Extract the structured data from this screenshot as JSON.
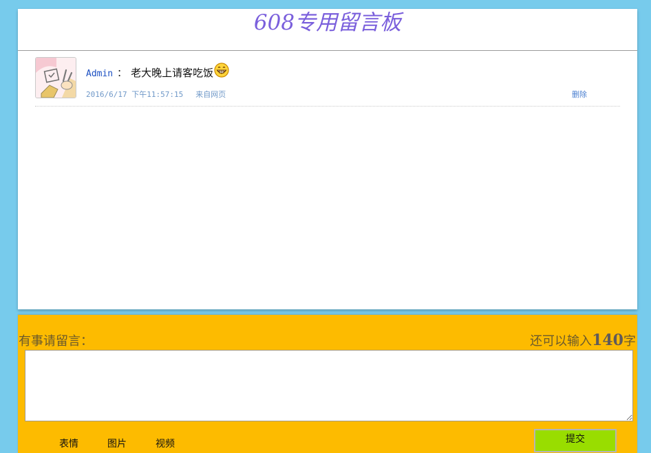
{
  "board": {
    "title": "608专用留言板",
    "messages": [
      {
        "author": "Admin",
        "separator": "：",
        "text": "老大晚上请客吃饭",
        "emoji": "grinning-face-icon",
        "time": "2016/6/17 下午11:57:15",
        "source": "来自网页",
        "delete_label": "删除"
      }
    ]
  },
  "compose": {
    "label": "有事请留言：",
    "count_prefix": "还可以输入",
    "count_value": "140",
    "count_suffix": "字",
    "textarea_value": "",
    "tools": [
      "表情",
      "图片",
      "视频"
    ],
    "submit_label": "提交"
  },
  "colors": {
    "page_background": "#77cbec",
    "board_background": "#ffffff",
    "title_color": "#7a5fdc",
    "compose_background": "#fdbb00",
    "submit_background": "#99dd00",
    "link_color": "#4a7fd0"
  }
}
